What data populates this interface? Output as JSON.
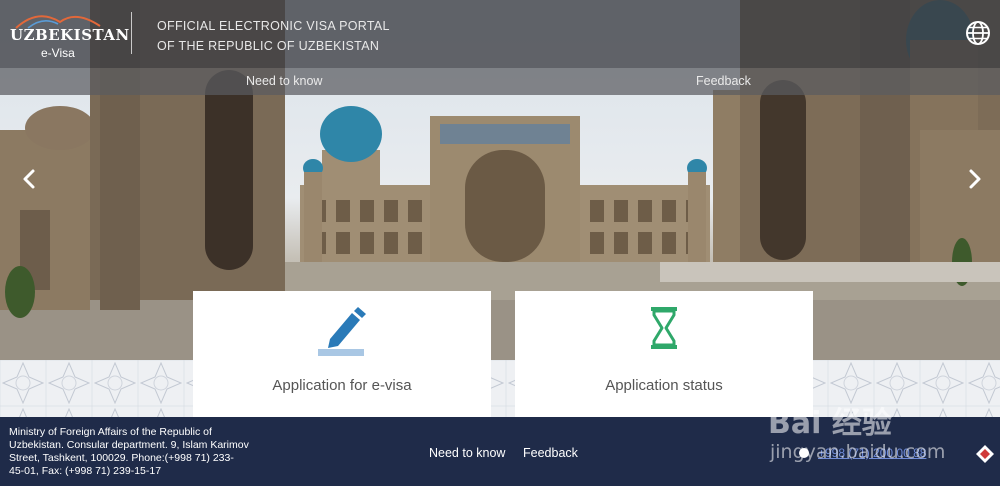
{
  "header": {
    "logo_brand": "UZBEKISTAN",
    "logo_sub": "e-Visa",
    "title_line1": "OFFICIAL ELECTRONIC VISA PORTAL",
    "title_line2": "OF THE REPUBLIC OF UZBEKISTAN",
    "language_icon": "globe-icon"
  },
  "nav": {
    "need_to_know": "Need to know",
    "feedback": "Feedback"
  },
  "carousel": {
    "prev_icon": "chevron-left-icon",
    "next_icon": "chevron-right-icon"
  },
  "cards": [
    {
      "label": "Application for e-visa",
      "icon": "pencil-icon",
      "color": "#2a7ab8"
    },
    {
      "label": "Application status",
      "icon": "hourglass-icon",
      "color": "#2fa86a"
    }
  ],
  "footer": {
    "address": "Ministry of Foreign Affairs of the Republic of Uzbekistan. Consular department. 9, Islam Karimov Street, Tashkent, 100029. Phone:(+998 71) 233-45-01, Fax: (+998 71) 239-15-17",
    "need_to_know": "Need to know",
    "feedback": "Feedback",
    "phone": "+998 (71) 200 00 88",
    "background": "#1f2b49"
  },
  "watermark": {
    "brand": "Bai  经验",
    "url": "jingyan.baidu.com"
  }
}
